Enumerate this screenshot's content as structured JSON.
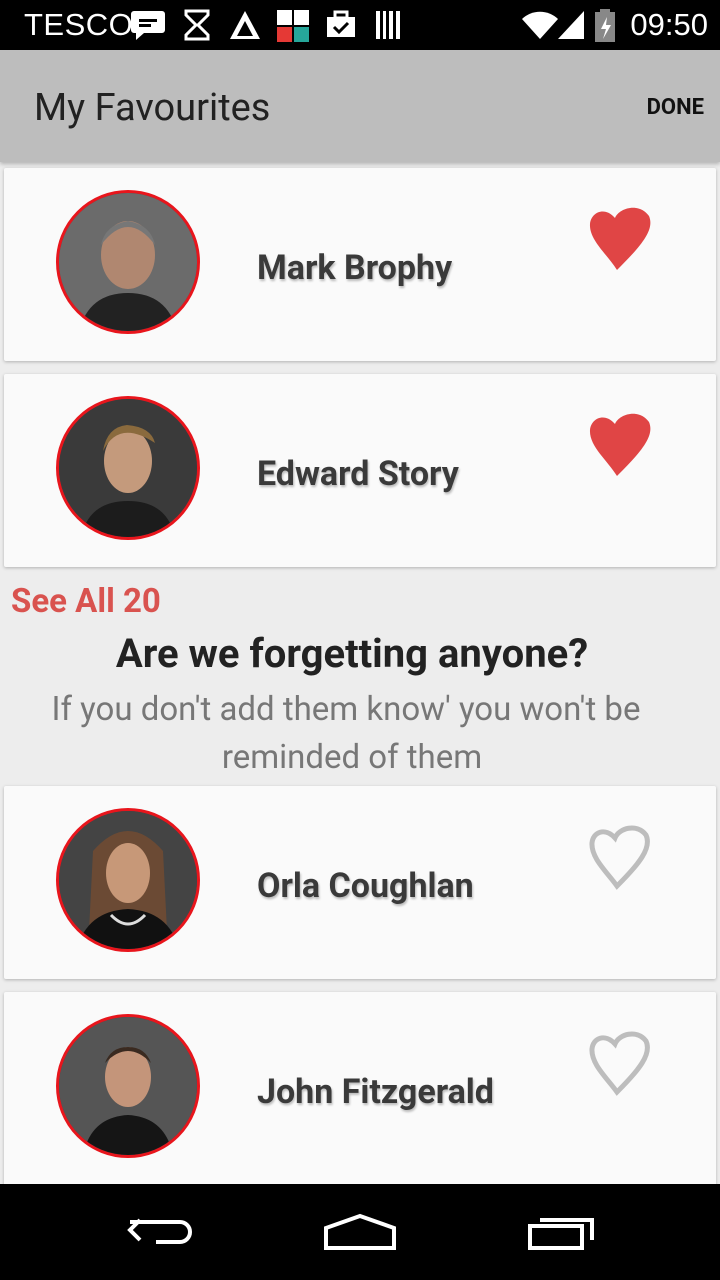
{
  "status_bar": {
    "carrier": "TESCO",
    "time": "09:50"
  },
  "app_bar": {
    "title": "My Favourites",
    "done_label": "DONE"
  },
  "favourites": [
    {
      "name": "Mark Brophy",
      "favourited": true
    },
    {
      "name": "Edward Story",
      "favourited": true
    }
  ],
  "see_all_label": "See All 20",
  "prompt": {
    "title": "Are we forgetting anyone?",
    "subtitle_line1": "If you don't add them know' you won't be",
    "subtitle_line2": "reminded of them"
  },
  "suggestions": [
    {
      "name": "Orla Coughlan",
      "favourited": false
    },
    {
      "name": "John Fitzgerald",
      "favourited": false
    }
  ],
  "colors": {
    "accent_red": "#e8151c",
    "heart_red": "#e04545",
    "link_red": "#d9534f",
    "app_bar_bg": "#bdbdbd"
  }
}
